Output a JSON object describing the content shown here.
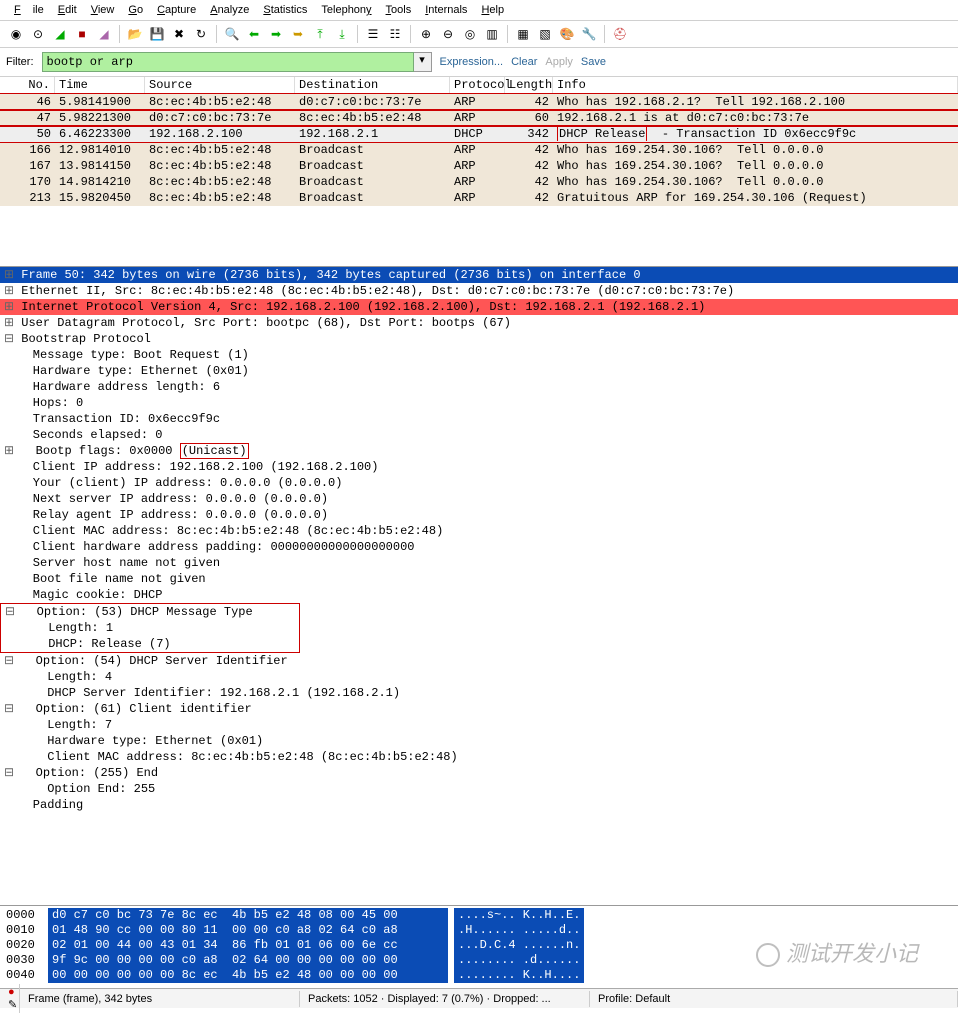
{
  "menu": {
    "file": "File",
    "edit": "Edit",
    "view": "View",
    "go": "Go",
    "capture": "Capture",
    "analyze": "Analyze",
    "statistics": "Statistics",
    "telephony": "Telephony",
    "tools": "Tools",
    "internals": "Internals",
    "help": "Help"
  },
  "filter": {
    "label": "Filter:",
    "value": "bootp or arp",
    "expression": "Expression...",
    "clear": "Clear",
    "apply": "Apply",
    "save": "Save"
  },
  "columns": {
    "no": "No.",
    "time": "Time",
    "source": "Source",
    "destination": "Destination",
    "protocol": "Protocol",
    "length": "Length",
    "info": "Info"
  },
  "packets": [
    {
      "no": "46",
      "time": "5.98141900",
      "src": "8c:ec:4b:b5:e2:48",
      "dst": "d0:c7:c0:bc:73:7e",
      "proto": "ARP",
      "len": "42",
      "info": "Who has 192.168.2.1?  Tell 192.168.2.100",
      "boxed": true
    },
    {
      "no": "47",
      "time": "5.98221300",
      "src": "d0:c7:c0:bc:73:7e",
      "dst": "8c:ec:4b:b5:e2:48",
      "proto": "ARP",
      "len": "60",
      "info": "192.168.2.1 is at d0:c7:c0:bc:73:7e",
      "boxed": true
    },
    {
      "no": "50",
      "time": "6.46223300",
      "src": "192.168.2.100",
      "dst": "192.168.2.1",
      "proto": "DHCP",
      "len": "342",
      "info_pre": "",
      "info_box": "DHCP Release",
      "info_post": "  - Transaction ID 0x6ecc9f9c",
      "boxed": true,
      "sel": true
    },
    {
      "no": "166",
      "time": "12.9814010",
      "src": "8c:ec:4b:b5:e2:48",
      "dst": "Broadcast",
      "proto": "ARP",
      "len": "42",
      "info": "Who has 169.254.30.106?  Tell 0.0.0.0"
    },
    {
      "no": "167",
      "time": "13.9814150",
      "src": "8c:ec:4b:b5:e2:48",
      "dst": "Broadcast",
      "proto": "ARP",
      "len": "42",
      "info": "Who has 169.254.30.106?  Tell 0.0.0.0"
    },
    {
      "no": "170",
      "time": "14.9814210",
      "src": "8c:ec:4b:b5:e2:48",
      "dst": "Broadcast",
      "proto": "ARP",
      "len": "42",
      "info": "Who has 169.254.30.106?  Tell 0.0.0.0"
    },
    {
      "no": "213",
      "time": "15.9820450",
      "src": "8c:ec:4b:b5:e2:48",
      "dst": "Broadcast",
      "proto": "ARP",
      "len": "42",
      "info": "Gratuitous ARP for 169.254.30.106 (Request)"
    }
  ],
  "details": [
    {
      "cl": "plus blueline",
      "txt": "Frame 50: 342 bytes on wire (2736 bits), 342 bytes captured (2736 bits) on interface 0"
    },
    {
      "cl": "plus",
      "txt": "Ethernet II, Src: 8c:ec:4b:b5:e2:48 (8c:ec:4b:b5:e2:48), Dst: d0:c7:c0:bc:73:7e (d0:c7:c0:bc:73:7e)"
    },
    {
      "cl": "plus redline",
      "txt": "Internet Protocol Version 4, Src: 192.168.2.100 (192.168.2.100), Dst: 192.168.2.1 (192.168.2.1)"
    },
    {
      "cl": "plus",
      "txt": "User Datagram Protocol, Src Port: bootpc (68), Dst Port: bootps (67)"
    },
    {
      "cl": "minus",
      "txt": "Bootstrap Protocol"
    },
    {
      "cl": "",
      "txt": "    Message type: Boot Request (1)"
    },
    {
      "cl": "",
      "txt": "    Hardware type: Ethernet (0x01)"
    },
    {
      "cl": "",
      "txt": "    Hardware address length: 6"
    },
    {
      "cl": "",
      "txt": "    Hops: 0"
    },
    {
      "cl": "",
      "txt": "    Transaction ID: 0x6ecc9f9c"
    },
    {
      "cl": "",
      "txt": "    Seconds elapsed: 0"
    },
    {
      "cl": "plus",
      "txt": "  Bootp flags: 0x0000 ",
      "box": "(Unicast)"
    },
    {
      "cl": "",
      "txt": "    Client IP address: 192.168.2.100 (192.168.2.100)"
    },
    {
      "cl": "",
      "txt": "    Your (client) IP address: 0.0.0.0 (0.0.0.0)"
    },
    {
      "cl": "",
      "txt": "    Next server IP address: 0.0.0.0 (0.0.0.0)"
    },
    {
      "cl": "",
      "txt": "    Relay agent IP address: 0.0.0.0 (0.0.0.0)"
    },
    {
      "cl": "",
      "txt": "    Client MAC address: 8c:ec:4b:b5:e2:48 (8c:ec:4b:b5:e2:48)"
    },
    {
      "cl": "",
      "txt": "    Client hardware address padding: 00000000000000000000"
    },
    {
      "cl": "",
      "txt": "    Server host name not given"
    },
    {
      "cl": "",
      "txt": "    Boot file name not given"
    },
    {
      "cl": "",
      "txt": "    Magic cookie: DHCP"
    },
    {
      "cl": "minus",
      "txt": "  Option: (53) DHCP Message Type",
      "boxstart": true
    },
    {
      "cl": "",
      "txt": "      Length: 1",
      "boxmid": true
    },
    {
      "cl": "",
      "txt": "      DHCP: Release (7)",
      "boxend": true
    },
    {
      "cl": "minus",
      "txt": "  Option: (54) DHCP Server Identifier"
    },
    {
      "cl": "",
      "txt": "      Length: 4"
    },
    {
      "cl": "",
      "txt": "      DHCP Server Identifier: 192.168.2.1 (192.168.2.1)"
    },
    {
      "cl": "minus",
      "txt": "  Option: (61) Client identifier"
    },
    {
      "cl": "",
      "txt": "      Length: 7"
    },
    {
      "cl": "",
      "txt": "      Hardware type: Ethernet (0x01)"
    },
    {
      "cl": "",
      "txt": "      Client MAC address: 8c:ec:4b:b5:e2:48 (8c:ec:4b:b5:e2:48)"
    },
    {
      "cl": "minus",
      "txt": "  Option: (255) End"
    },
    {
      "cl": "",
      "txt": "      Option End: 255"
    },
    {
      "cl": "",
      "txt": "    Padding"
    }
  ],
  "hex": [
    {
      "off": "0000",
      "b": "d0 c7 c0 bc 73 7e 8c ec  4b b5 e2 48 08 00 45 00",
      "a": "....s~.. K..H..E."
    },
    {
      "off": "0010",
      "b": "01 48 90 cc 00 00 80 11  00 00 c0 a8 02 64 c0 a8",
      "a": ".H...... .....d.."
    },
    {
      "off": "0020",
      "b": "02 01 00 44 00 43 01 34  86 fb 01 01 06 00 6e cc",
      "a": "...D.C.4 ......n."
    },
    {
      "off": "0030",
      "b": "9f 9c 00 00 00 00 c0 a8  02 64 00 00 00 00 00 00",
      "a": "........ .d......"
    },
    {
      "off": "0040",
      "b": "00 00 00 00 00 00 8c ec  4b b5 e2 48 00 00 00 00",
      "a": "........ K..H...."
    }
  ],
  "status": {
    "frame": "Frame (frame), 342 bytes",
    "packets": "Packets: 1052 · Displayed: 7 (0.7%) · Dropped: ...",
    "profile": "Profile: Default"
  },
  "watermark": "测试开发小记"
}
